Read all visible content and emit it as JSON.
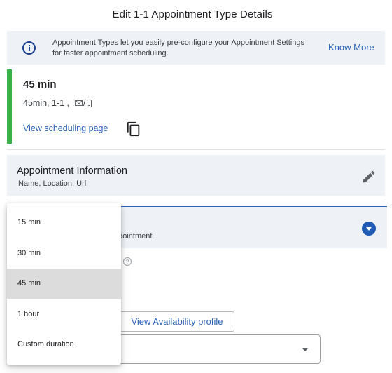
{
  "header": {
    "title": "Edit 1-1 Appointment Type Details"
  },
  "info_banner": {
    "icon": "info-icon",
    "text": "Appointment Types let you easily pre-configure your Appointment Settings for faster appointment scheduling.",
    "link": "Know More"
  },
  "summary": {
    "title": "45 min",
    "meta": "45min, 1-1 ,",
    "icons": [
      "mail-icon",
      "phone-icon"
    ],
    "view_link": "View scheduling page",
    "accent_color": "#3bb04a"
  },
  "appointment_info": {
    "title": "Appointment Information",
    "subtitle": "Name, Location, Url"
  },
  "section2": {
    "title_fragment": "s",
    "subtitle_fragment": "ppointment"
  },
  "availability": {
    "help_icon": "?",
    "button_label": "View Availability profile"
  },
  "duration_dropdown": {
    "options": [
      "15 min",
      "30 min",
      "45 min",
      "1 hour",
      "Custom duration"
    ],
    "selected": "45 min"
  },
  "colors": {
    "link": "#2a62b8",
    "panel_bg": "#eef2f7",
    "accent_green": "#3bb04a",
    "primary_blue": "#1f5bb5"
  }
}
